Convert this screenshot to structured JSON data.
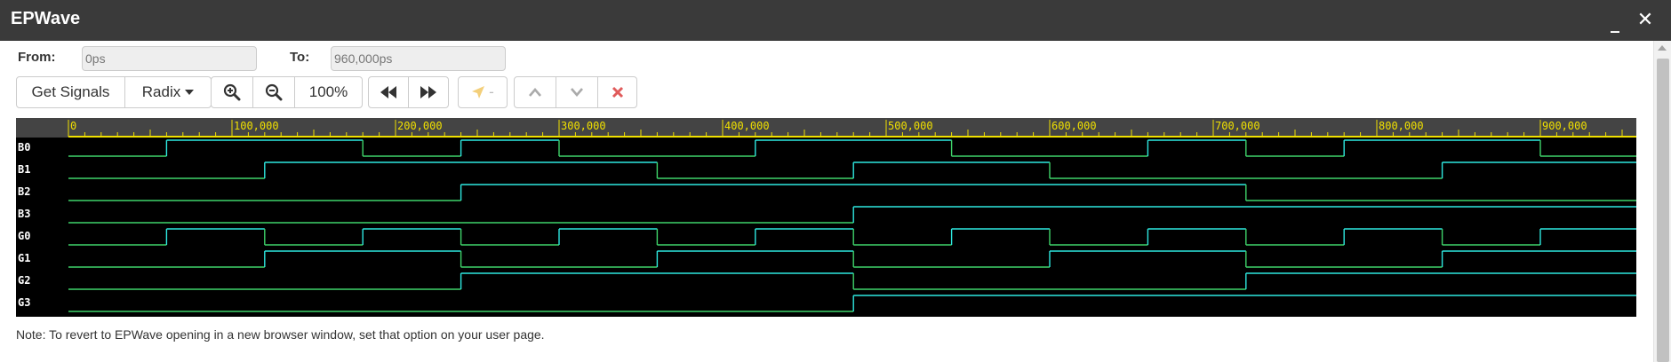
{
  "window": {
    "title": "EPWave",
    "minimize_glyph": "_",
    "close_glyph": "✕"
  },
  "range": {
    "from_label": "From:",
    "from_value": "0ps",
    "to_label": "To:",
    "to_value": "960,000ps"
  },
  "toolbar": {
    "get_signals_label": "Get Signals",
    "radix_label": "Radix",
    "zoom_in_icon": "zoom-in-icon",
    "zoom_out_icon": "zoom-out-icon",
    "zoom_level": "100%",
    "prev_edge_icon": "rewind-icon",
    "next_edge_icon": "fast-forward-icon",
    "cursor_icon": "pointer-arrow-icon",
    "cursor_value": "-",
    "move_up_icon": "chevron-up-icon",
    "move_down_icon": "chevron-down-icon",
    "remove_icon": "close-icon",
    "remove_color": "#e05b5b"
  },
  "timeline": {
    "unit": "ps",
    "range": [
      0,
      960000
    ],
    "tick_labels": [
      "0",
      "100,000",
      "200,000",
      "300,000",
      "400,000",
      "500,000",
      "600,000",
      "700,000",
      "800,000",
      "900,000"
    ],
    "ruler_color": "#f0e000",
    "wave_high_color": "#2ee8e0",
    "wave_low_color": "#3fd46a",
    "signals": [
      {
        "name": "B0",
        "initial": 0,
        "transitions": [
          60000,
          180000,
          240000,
          300000,
          420000,
          540000,
          660000,
          720000,
          780000,
          900000
        ]
      },
      {
        "name": "B1",
        "initial": 0,
        "transitions": [
          120000,
          360000,
          480000,
          600000,
          840000
        ]
      },
      {
        "name": "B2",
        "initial": 0,
        "transitions": [
          240000,
          720000
        ]
      },
      {
        "name": "B3",
        "initial": 0,
        "transitions": [
          480000
        ]
      },
      {
        "name": "G0",
        "initial": 0,
        "transitions": [
          60000,
          120000,
          180000,
          240000,
          300000,
          360000,
          420000,
          480000,
          540000,
          600000,
          660000,
          720000,
          780000,
          840000,
          900000
        ]
      },
      {
        "name": "G1",
        "initial": 0,
        "transitions": [
          120000,
          240000,
          360000,
          480000,
          600000,
          720000,
          840000
        ]
      },
      {
        "name": "G2",
        "initial": 0,
        "transitions": [
          240000,
          480000,
          720000
        ]
      },
      {
        "name": "G3",
        "initial": 0,
        "transitions": [
          480000
        ]
      }
    ]
  },
  "note": "Note: To revert to EPWave opening in a new browser window, set that option on your user page."
}
